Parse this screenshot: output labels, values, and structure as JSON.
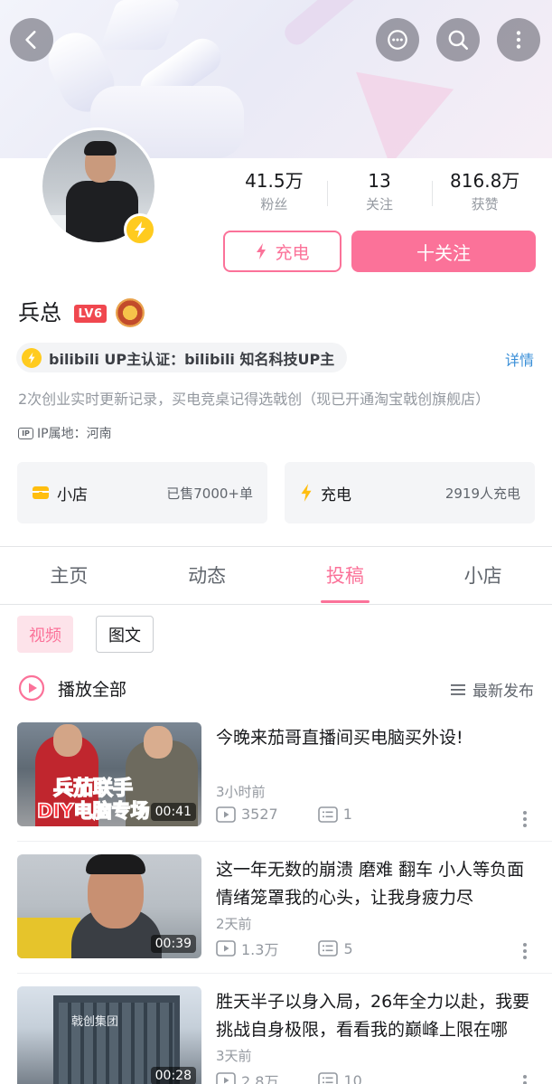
{
  "profile": {
    "name": "兵总",
    "level": "LV6",
    "stats": [
      {
        "value": "41.5万",
        "label": "粉丝"
      },
      {
        "value": "13",
        "label": "关注"
      },
      {
        "value": "816.8万",
        "label": "获赞"
      }
    ],
    "charge_button": "充电",
    "follow_button": "十关注",
    "verify": "bilibili UP主认证：bilibili 知名科技UP主",
    "detail_link": "详情",
    "sign": "2次创业实时更新记录，买电竞桌记得选戟创（现已开通淘宝戟创旗舰店）",
    "ip": "IP属地：河南",
    "ip_badge": "IP"
  },
  "cards": [
    {
      "label": "小店",
      "value": "已售7000+单",
      "icon": "shop-icon"
    },
    {
      "label": "充电",
      "value": "2919人充电",
      "icon": "lightning-icon"
    }
  ],
  "tabs": [
    "主页",
    "动态",
    "投稿",
    "小店"
  ],
  "active_tab": 2,
  "chips": [
    "视频",
    "图文"
  ],
  "playall": "播放全部",
  "sort": "最新发布",
  "videos": [
    {
      "title": "今晚来茄哥直播间买电脑买外设!",
      "time": "3小时前",
      "plays": "3527",
      "comments": "1",
      "duration": "00:41",
      "overlay_line1": "兵茄联手",
      "overlay_line2": "DIY电脑专场"
    },
    {
      "title": "这一年无数的崩溃 磨难 翻车 小人等负面情绪笼罩我的心头，让我身疲力尽",
      "time": "2天前",
      "plays": "1.3万",
      "comments": "5",
      "duration": "00:39"
    },
    {
      "title": "胜天半子以身入局，26年全力以赴，我要挑战自身极限，看看我的巅峰上限在哪",
      "time": "3天前",
      "plays": "2.8万",
      "comments": "10",
      "duration": "00:28",
      "building_sign": "戟创集团"
    }
  ],
  "colors": {
    "brand_pink": "#fb7299",
    "charge_yellow": "#ffcb1f",
    "link_blue": "#3a8fd8"
  }
}
